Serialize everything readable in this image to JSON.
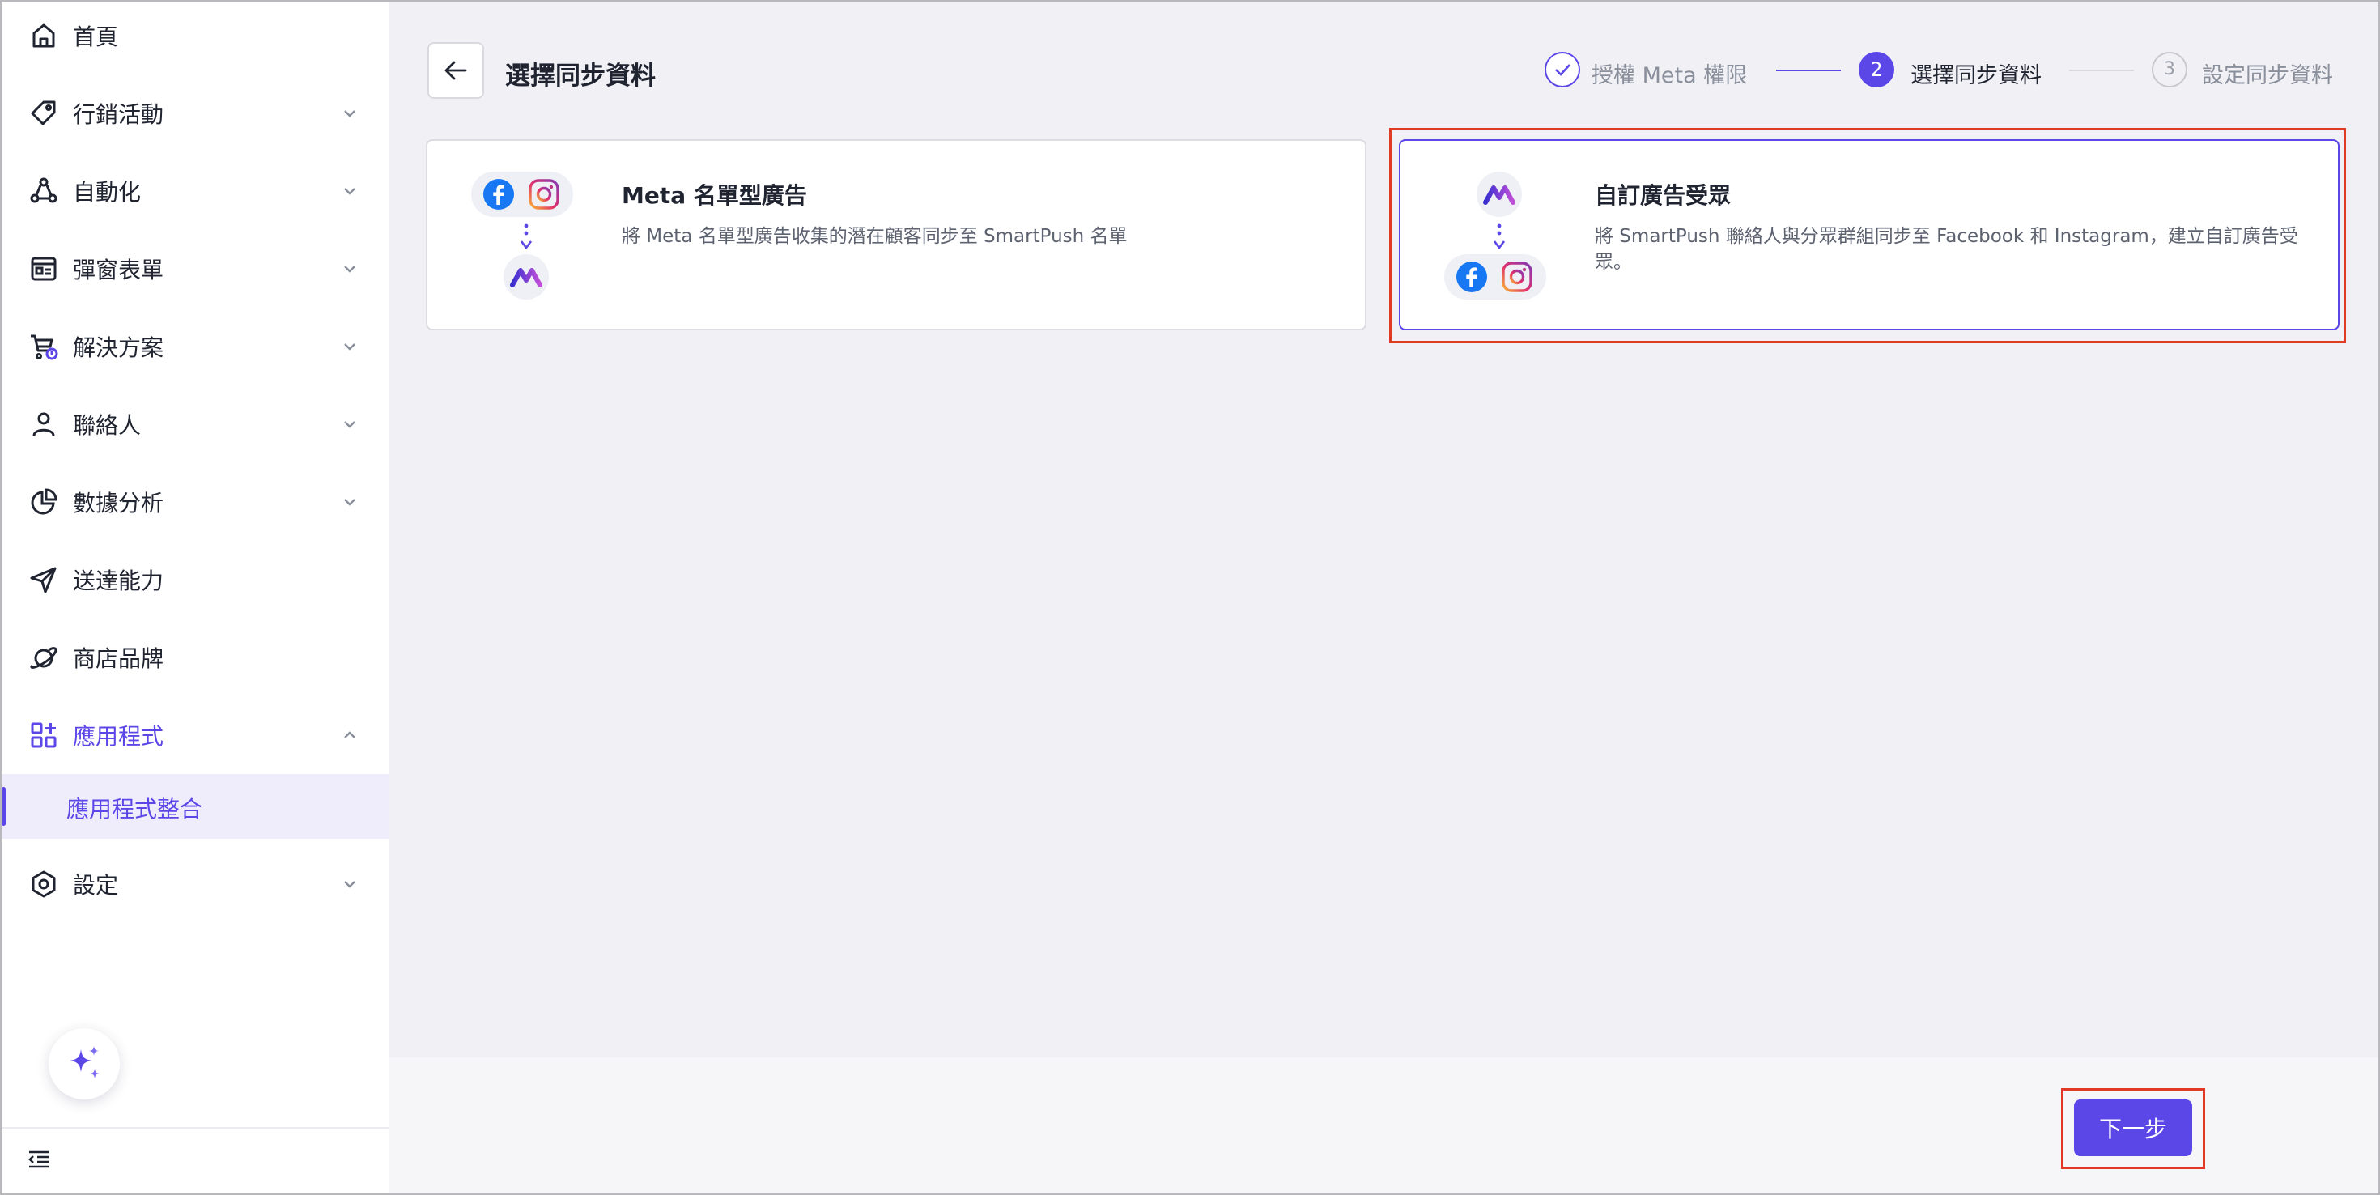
{
  "sidebar": {
    "items": [
      {
        "label": "首頁",
        "icon": "home-icon"
      },
      {
        "label": "行銷活動",
        "icon": "tag-icon"
      },
      {
        "label": "自動化",
        "icon": "automation-icon"
      },
      {
        "label": "彈窗表單",
        "icon": "form-icon"
      },
      {
        "label": "解決方案",
        "icon": "cart-icon"
      },
      {
        "label": "聯絡人",
        "icon": "user-icon"
      },
      {
        "label": "數據分析",
        "icon": "chart-icon"
      },
      {
        "label": "送達能力",
        "icon": "send-icon"
      },
      {
        "label": "商店品牌",
        "icon": "planet-icon"
      },
      {
        "label": "應用程式",
        "icon": "apps-icon"
      },
      {
        "label": "設定",
        "icon": "settings-icon"
      }
    ],
    "sub_item": {
      "label": "應用程式整合"
    }
  },
  "header": {
    "title": "選擇同步資料"
  },
  "steps": [
    {
      "label": "授權 Meta 權限",
      "state": "done"
    },
    {
      "label": "選擇同步資料",
      "number": "2",
      "state": "active"
    },
    {
      "label": "設定同步資料",
      "number": "3",
      "state": "pending"
    }
  ],
  "cards": [
    {
      "title": "Meta 名單型廣告",
      "description": "將 Meta 名單型廣告收集的潛在顧客同步至 SmartPush 名單",
      "selected": false
    },
    {
      "title": "自訂廣告受眾",
      "description": "將 SmartPush 聯絡人與分眾群組同步至 Facebook 和 Instagram，建立自訂廣告受眾。",
      "selected": true
    }
  ],
  "footer": {
    "next_label": "下一步"
  },
  "colors": {
    "accent": "#5b46e8",
    "highlight": "#e03a25",
    "facebook": "#1877f2"
  }
}
